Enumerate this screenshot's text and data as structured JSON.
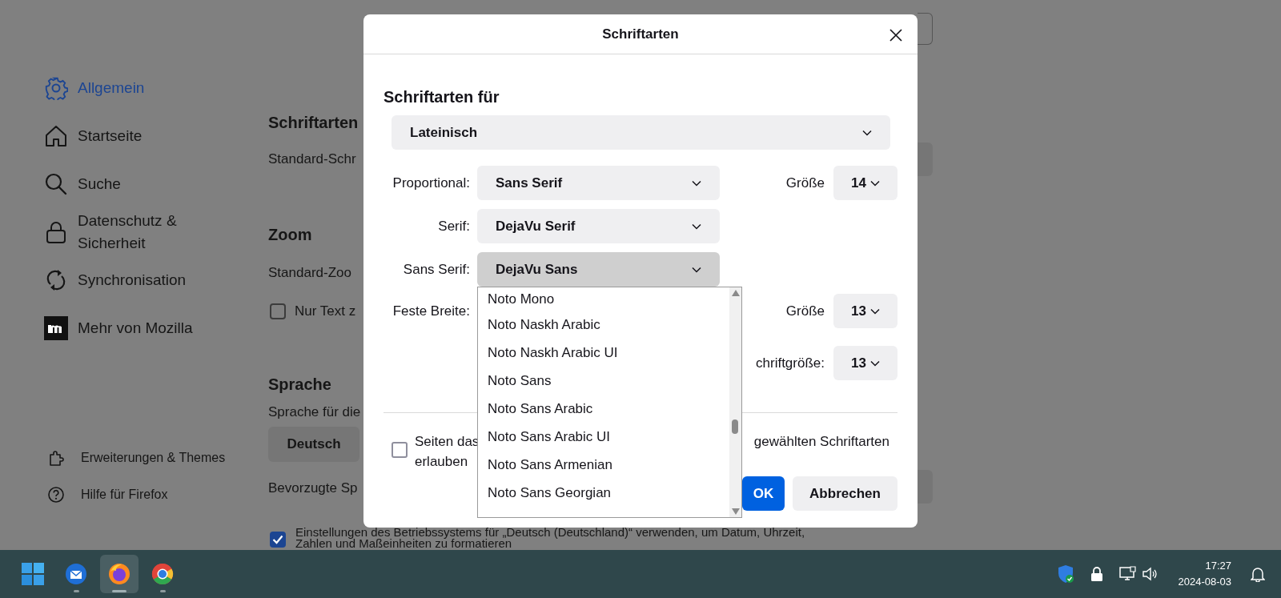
{
  "sidebar": {
    "items": [
      {
        "label": "Allgemein",
        "selected": true
      },
      {
        "label": "Startseite",
        "selected": false
      },
      {
        "label": "Suche",
        "selected": false
      },
      {
        "label": "Datenschutz & Sicherheit",
        "selected": false
      },
      {
        "label": "Synchronisation",
        "selected": false
      },
      {
        "label": "Mehr von Mozilla",
        "selected": false
      }
    ],
    "footer_links": [
      "Erweiterungen & Themes",
      "Hilfe für Firefox"
    ]
  },
  "content": {
    "fonts_heading": "Schriftarten",
    "default_font_label": "Standard-Schr",
    "zoom_heading": "Zoom",
    "default_zoom_label": "Standard-Zoo",
    "text_zoom": {
      "label": "Nur Text z",
      "checked": false
    },
    "language_heading": "Sprache",
    "language_label": "Sprache für die",
    "language_button": "Deutsch",
    "preferred_label": "Bevorzugte Sp",
    "regional_format": {
      "lines": [
        "Einstellungen des Betriebssystems für „Deutsch (Deutschland)“ verwenden, um Datum, Uhrzeit,",
        "Zahlen und Maßeinheiten zu formatieren"
      ],
      "checked": true
    }
  },
  "dialog": {
    "title": "Schriftarten",
    "heading": "Schriftarten für",
    "script_select": "Lateinisch",
    "rows": [
      {
        "label": "Proportional:",
        "value": "Sans Serif",
        "expanded": false,
        "size_label": "Größe",
        "size": "14"
      },
      {
        "label": "Serif:",
        "value": "DejaVu Serif",
        "expanded": false
      },
      {
        "label": "Sans Serif:",
        "value": "DejaVu Sans",
        "expanded": true
      },
      {
        "label": "Feste Breite:",
        "size_label": "Größe",
        "size": "13"
      }
    ],
    "min_size": {
      "label": "chriftgröße:",
      "size": "13"
    },
    "override": {
      "parts": [
        "Seiten das",
        "gewählten Schriftarten",
        "erlauben"
      ],
      "checked": false
    },
    "buttons": [
      {
        "label": "OK",
        "primary": true
      },
      {
        "label": "Abbrechen",
        "primary": false
      }
    ],
    "dropdown_list": {
      "items": [
        "Noto Mono",
        "Noto Naskh Arabic",
        "Noto Naskh Arabic UI",
        "Noto Sans",
        "Noto Sans Arabic",
        "Noto Sans Arabic UI",
        "Noto Sans Armenian",
        "Noto Sans Georgian"
      ]
    }
  },
  "taskbar": {
    "apps": [
      {
        "running": false,
        "active": false
      },
      {
        "running": true,
        "active": false
      },
      {
        "running": true,
        "active": true
      },
      {
        "running": true,
        "active": false
      }
    ],
    "time": "17:27",
    "date": "2024-08-03"
  }
}
